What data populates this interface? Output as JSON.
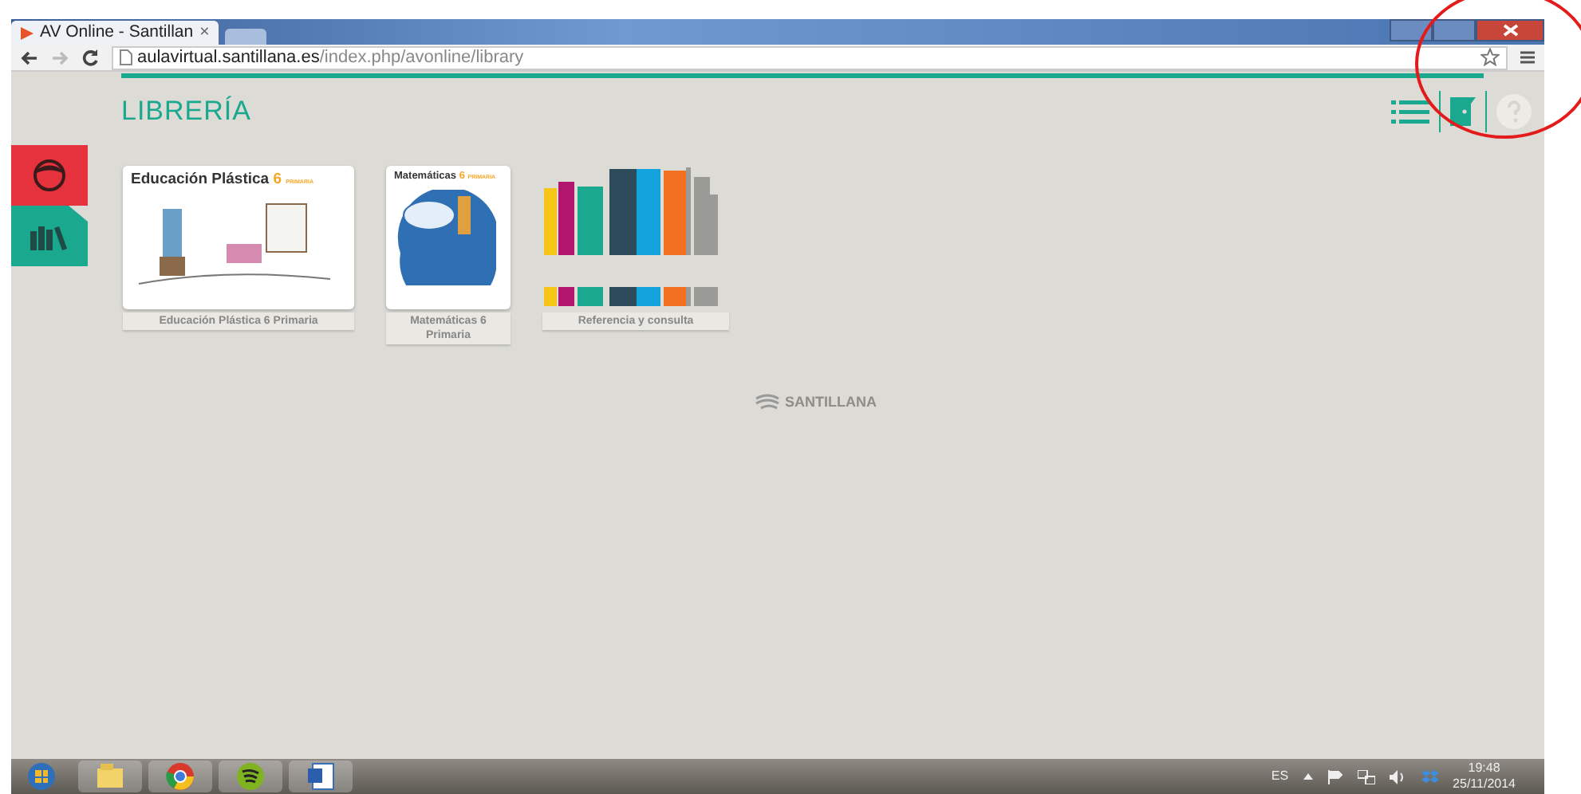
{
  "browser": {
    "tabs": [
      {
        "title": "AV Online - Santillan",
        "close": "×",
        "selected": true
      },
      {
        "selected": false
      }
    ],
    "url": {
      "host": "aulavirtual.santillana.es",
      "path": "/index.php/avonline/library"
    }
  },
  "page": {
    "title": "LIBRERÍA",
    "sidebar": [
      {
        "kind": "profile",
        "color": "#e5323c",
        "selected": false
      },
      {
        "kind": "library",
        "color": "#1aa88e",
        "selected": true
      }
    ],
    "books": [
      {
        "kind": "art",
        "cover_title": "Educación Plástica",
        "cover_number": "6",
        "cover_sub": "PRIMARIA",
        "label": "Educación Plástica 6 Primaria"
      },
      {
        "kind": "math",
        "cover_title": "Matemáticas",
        "cover_number": "6",
        "cover_sub": "PRIMARIA",
        "label": "Matemáticas 6 Primaria"
      },
      {
        "kind": "shelf",
        "label": "Referencia y consulta"
      }
    ],
    "logo": "SANTILLANA"
  },
  "taskbar": {
    "apps": [
      {
        "kind": "start"
      },
      {
        "kind": "explorer"
      },
      {
        "kind": "chrome"
      },
      {
        "kind": "spotify"
      },
      {
        "kind": "word"
      }
    ],
    "language": "ES",
    "time": "19:48",
    "date": "25/11/2014"
  }
}
